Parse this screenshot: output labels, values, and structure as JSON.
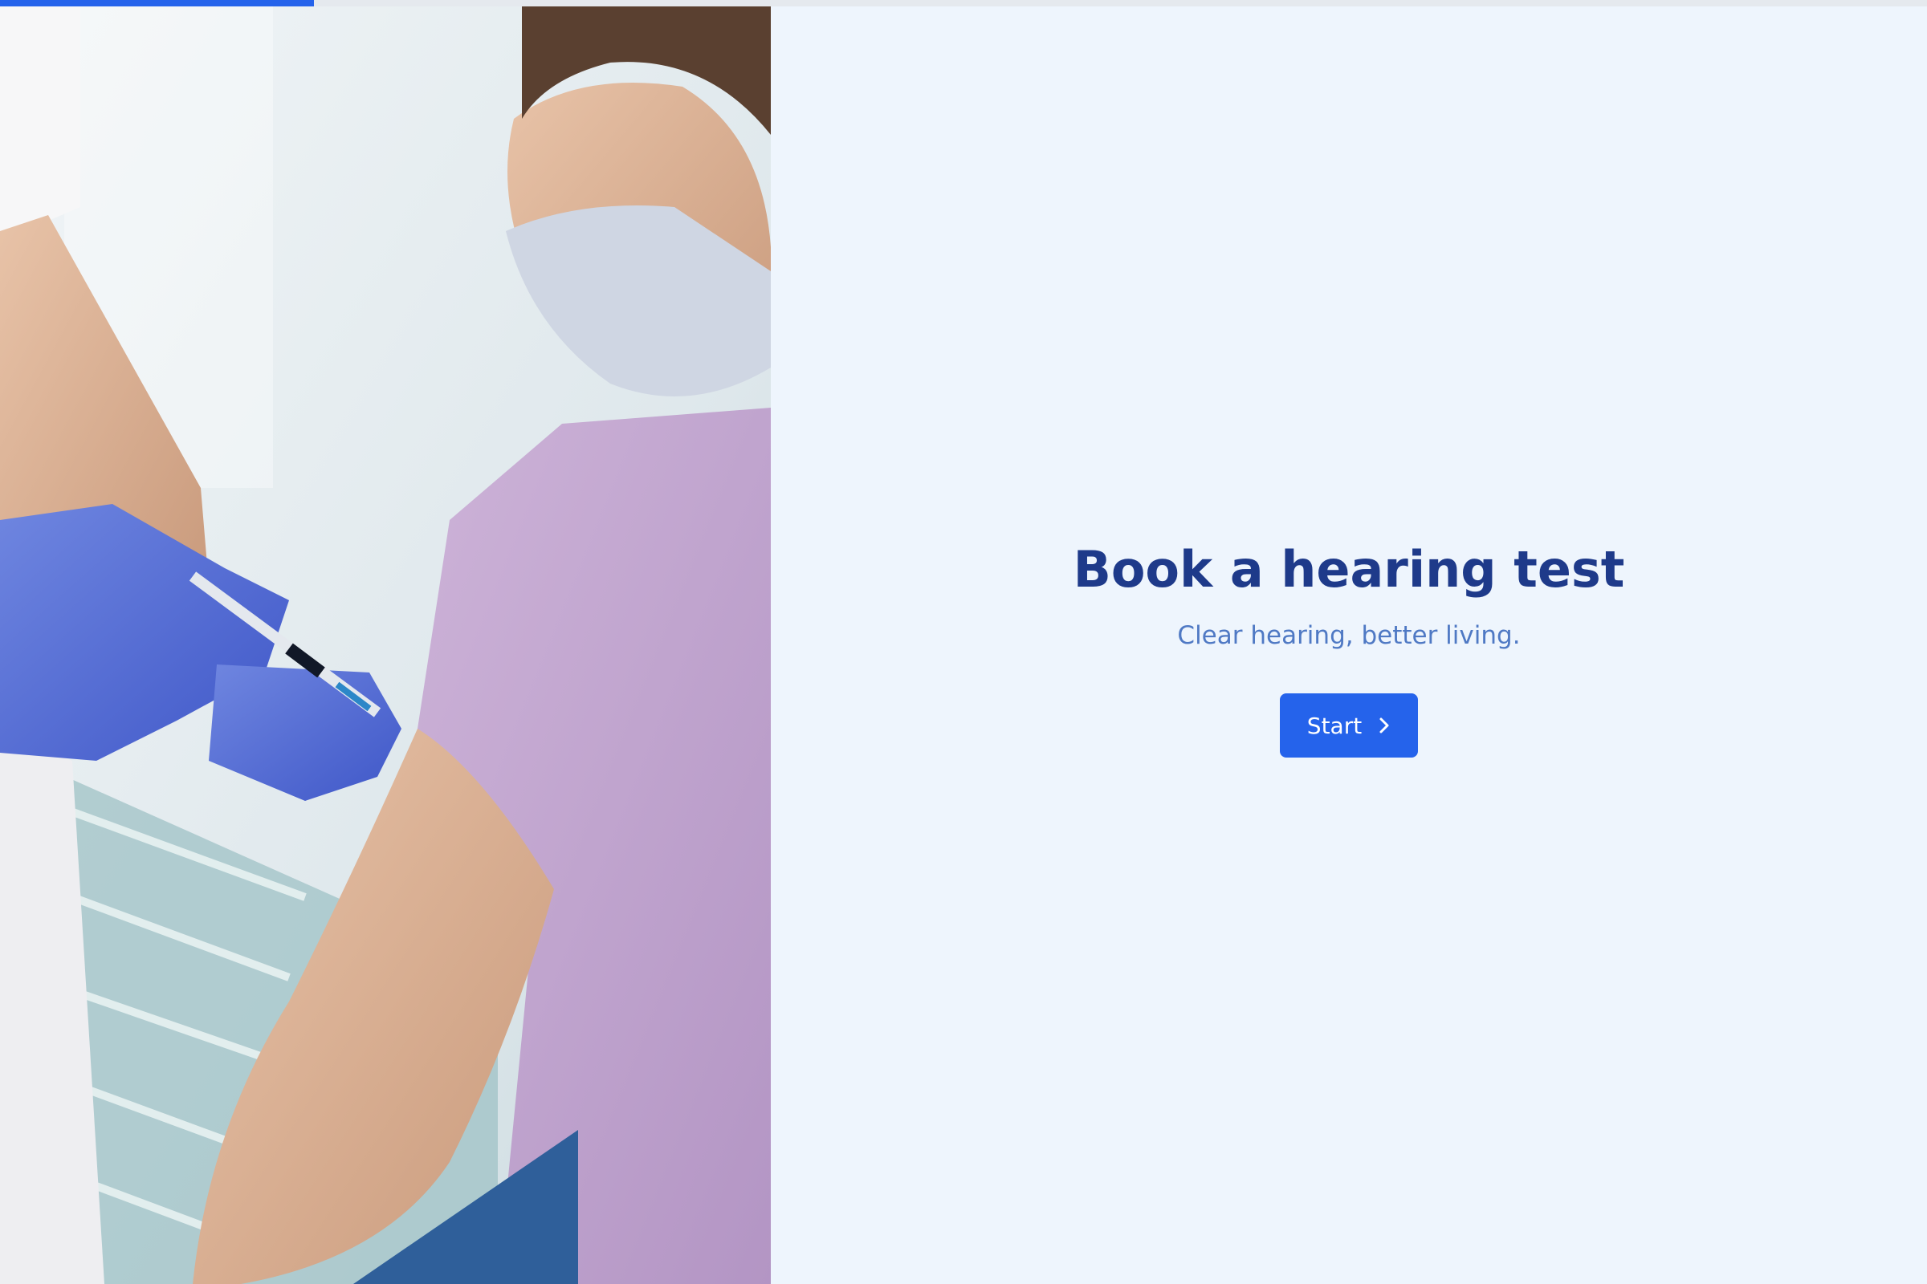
{
  "progress": {
    "value": 0.163
  },
  "hero": {
    "image_icon": "vaccination-photo",
    "title": "Book a hearing test",
    "subtitle": "Clear hearing, better living.",
    "start_label": "Start",
    "start_icon": "chevron-right-icon"
  },
  "colors": {
    "accent": "#2563eb",
    "title": "#1e3a8a",
    "subtitle": "#4f79c4",
    "background": "#eef5fd",
    "track": "#e5e9ee"
  }
}
